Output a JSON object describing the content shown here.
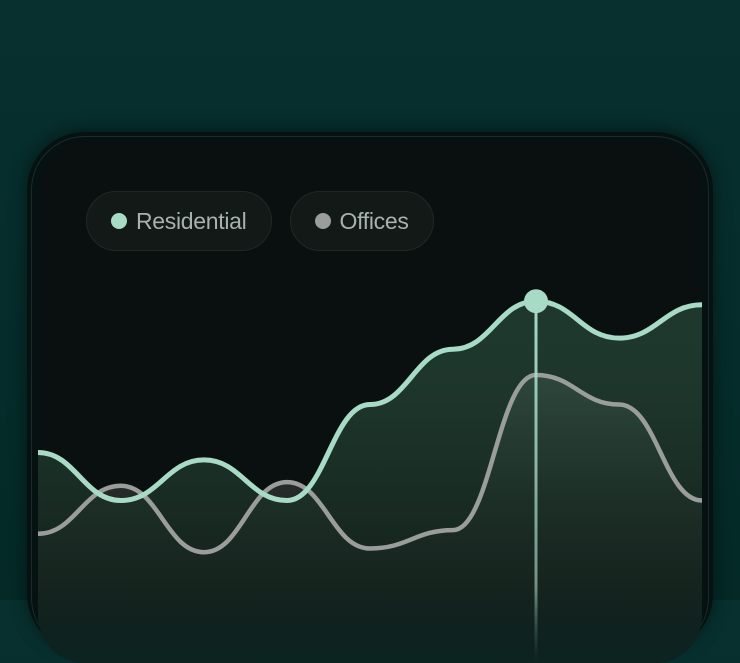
{
  "chart_data": {
    "type": "area",
    "legend": [
      {
        "label": "Residential",
        "color": "#a7dbc5"
      },
      {
        "label": "Offices",
        "color": "#9a9d9c"
      }
    ],
    "x": [
      0,
      1,
      2,
      3,
      4,
      5,
      6,
      7,
      8
    ],
    "series": [
      {
        "name": "Residential",
        "values": [
          57,
          44,
          55,
          44,
          70,
          85,
          98,
          88,
          97
        ],
        "color": "#a7dbc5"
      },
      {
        "name": "Offices",
        "values": [
          35,
          48,
          30,
          49,
          31,
          36,
          78,
          70,
          44
        ],
        "color": "#9a9d9c"
      }
    ],
    "highlight_index": 6,
    "ylim": [
      0,
      130
    ],
    "grid": false
  },
  "colors": {
    "background": "#063130",
    "screen": "#0a0f0f",
    "residential": "#a7dbc5",
    "offices": "#9a9d9c"
  }
}
